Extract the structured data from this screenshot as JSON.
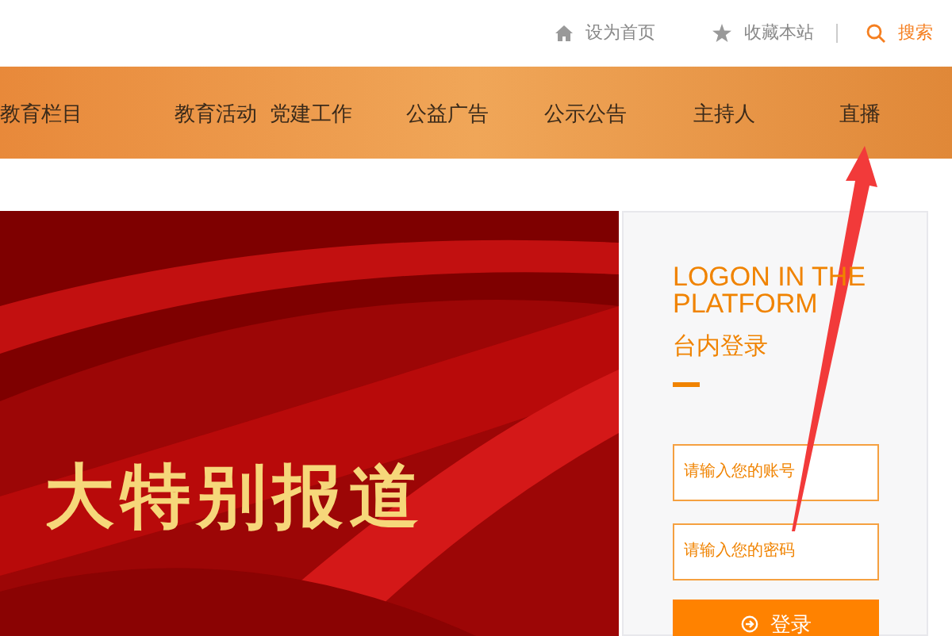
{
  "top_links": [
    {
      "kind": "home",
      "label": "设为首页"
    },
    {
      "kind": "star",
      "label": "收藏本站"
    },
    {
      "kind": "search",
      "label": "搜索"
    }
  ],
  "nav": [
    {
      "label": "教育栏目"
    },
    {
      "label": "教育活动"
    },
    {
      "label": "党建工作"
    },
    {
      "label": "公益广告"
    },
    {
      "label": "公示公告"
    },
    {
      "label": "主持人"
    },
    {
      "label": "直播"
    }
  ],
  "banner": {
    "title": "大特别报道"
  },
  "login": {
    "title": "LOGON IN THE PLATFORM",
    "subtitle": "台内登录",
    "fields": [
      {
        "placeholder": "请输入您的账号"
      },
      {
        "placeholder": "请输入您的密码"
      }
    ],
    "button": "登录"
  }
}
